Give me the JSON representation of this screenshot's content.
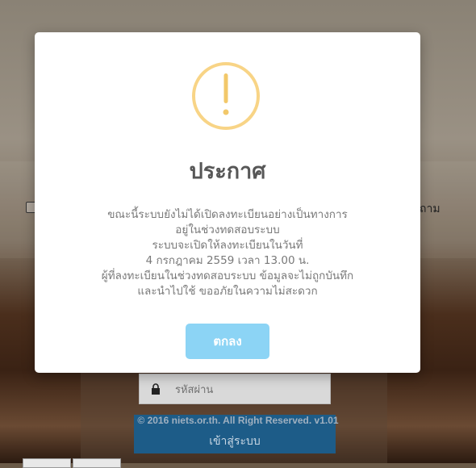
{
  "background": {
    "right_text_fragment": "ถาม",
    "password_placeholder": "รหัสผ่าน",
    "login_button_label": "เข้าสู่ระบบ",
    "copyright": "© 2016 niets.or.th. All Right Reserved. v1.01"
  },
  "modal": {
    "icon": "warning-icon",
    "icon_color": "#f8d486",
    "title": "ประกาศ",
    "body_lines": [
      "ขณะนี้ระบบยังไม่ได้เปิดลงทะเบียนอย่างเป็นทางการ",
      "อยู่ในช่วงทดสอบระบบ",
      "ระบบจะเปิดให้ลงทะเบียนในวันที่",
      "4 กรกฎาคม 2559 เวลา 13.00 น.",
      "ผู้ที่ลงทะเบียนในช่วงทดสอบระบบ ข้อมูลจะไม่ถูกบันทึก",
      "และนำไปใช้ ขออภัยในความไม่สะดวก"
    ],
    "ok_label": "ตกลง",
    "ok_color": "#8cd4f5"
  }
}
